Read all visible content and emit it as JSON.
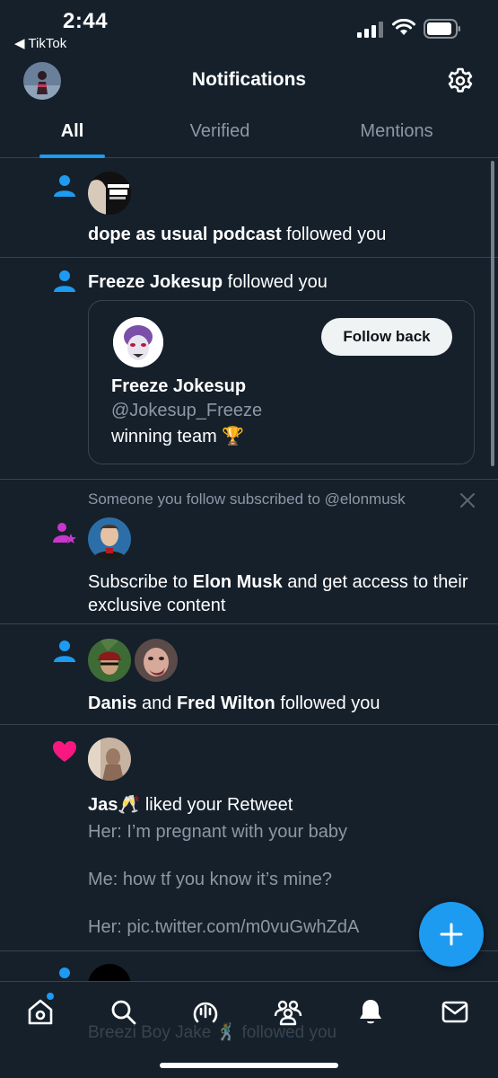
{
  "status_bar": {
    "time": "2:44",
    "back_app": "◀ TikTok"
  },
  "header": {
    "title": "Notifications"
  },
  "tabs": [
    {
      "label": "All",
      "active": true
    },
    {
      "label": "Verified",
      "active": false
    },
    {
      "label": "Mentions",
      "active": false
    }
  ],
  "notifications": [
    {
      "type": "follow",
      "icon": "person-icon",
      "user": "dope as usual podcast",
      "action": " followed you"
    },
    {
      "type": "follow",
      "icon": "person-icon",
      "user": "Freeze Jokesup",
      "action": " followed you",
      "card": {
        "name": "Freeze Jokesup",
        "handle": "@Jokesup_Freeze",
        "bio": "winning team 🏆",
        "button": "Follow back"
      }
    },
    {
      "type": "subscription",
      "icon": "person-star-icon",
      "context": "Someone you follow subscribed to @elonmusk",
      "text_before": "Subscribe to ",
      "user": "Elon Musk",
      "text_after": " and get access to their exclusive content"
    },
    {
      "type": "follow",
      "icon": "person-icon",
      "user1": "Danis",
      "joiner": " and ",
      "user2": "Fred Wilton",
      "action": " followed you"
    },
    {
      "type": "like",
      "icon": "heart-icon",
      "user": "Jas🥂",
      "action": "  liked your Retweet",
      "tweet_lines": [
        "Her: I’m pregnant with your baby",
        "Me: how tf you know it’s mine?",
        "Her: pic.twitter.com/m0vuGwhZdA"
      ]
    },
    {
      "type": "follow",
      "icon": "person-icon",
      "peek_text": "Breezi Boy Jake 🕺 followed you"
    }
  ],
  "colors": {
    "background": "#15202b",
    "accent": "#1d9bf0",
    "secondary_text": "#8b98a5",
    "divider": "#38444d",
    "like": "#f91880",
    "subscribe": "#c936cc"
  },
  "bottom_nav": [
    {
      "icon": "home-icon",
      "has_dot": true
    },
    {
      "icon": "search-icon"
    },
    {
      "icon": "spaces-icon"
    },
    {
      "icon": "communities-icon"
    },
    {
      "icon": "bell-icon",
      "active": true
    },
    {
      "icon": "mail-icon"
    }
  ]
}
